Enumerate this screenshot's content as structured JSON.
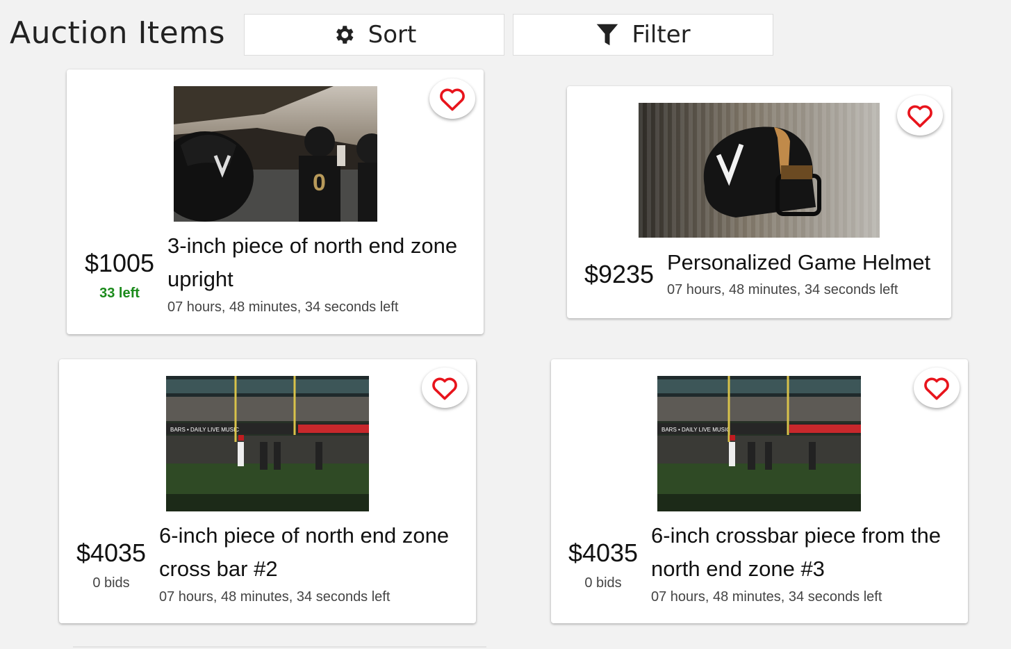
{
  "header": {
    "title": "Auction Items",
    "sort_label": "Sort",
    "filter_label": "Filter"
  },
  "icons": {
    "sort": "gear-icon",
    "filter": "funnel-icon",
    "favorite": "heart-outline-icon"
  },
  "colors": {
    "heart": "#e8141c",
    "remaining": "#1a8a1a"
  },
  "items": [
    {
      "price": "$1005",
      "status": "33 left",
      "title_line1": "3-inch piece of north end zone",
      "title_line2": "upright",
      "time_left": "07 hours, 48 minutes, 34 seconds left"
    },
    {
      "price": "$9235",
      "title_line1": "Personalized Game Helmet",
      "time_left": "07 hours, 48 minutes, 34 seconds left"
    },
    {
      "price": "$4035",
      "status": "0 bids",
      "title_line1": "6-inch piece of north end zone",
      "title_line2": "cross bar #2",
      "time_left": "07 hours, 48 minutes, 34 seconds left"
    },
    {
      "price": "$4035",
      "status": "0 bids",
      "title_line1": "6-inch crossbar piece from the",
      "title_line2": "north end zone #3",
      "time_left": "07 hours, 48 minutes, 34 seconds left"
    }
  ]
}
